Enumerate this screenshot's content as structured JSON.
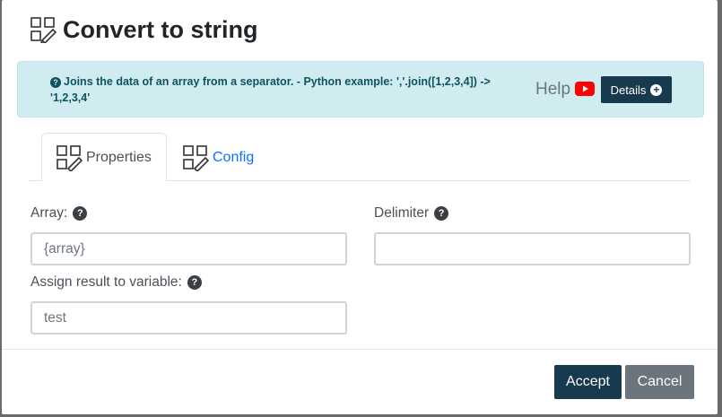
{
  "dialog": {
    "title": "Convert to string",
    "title_icon": "form-edit-icon"
  },
  "info": {
    "text": "Joins the data of an array from a separator. - Python example: ','.join([1,2,3,4]) -> '1,2,3,4'",
    "help_label": "Help",
    "details_label": "Details",
    "colors": {
      "background": "#d1ecf1",
      "text": "#0c5460",
      "details_bg": "#173a4f",
      "youtube": "#ff0000"
    }
  },
  "tabs": [
    {
      "label": "Properties",
      "icon": "form-edit-icon",
      "active": true
    },
    {
      "label": "Config",
      "icon": "form-edit-icon",
      "active": false
    }
  ],
  "form": {
    "array": {
      "label": "Array:",
      "value": "{array}"
    },
    "delimiter": {
      "label": "Delimiter",
      "value": ""
    },
    "assign": {
      "label": "Assign result to variable:",
      "value": "test"
    }
  },
  "footer": {
    "accept_label": "Accept",
    "cancel_label": "Cancel"
  }
}
